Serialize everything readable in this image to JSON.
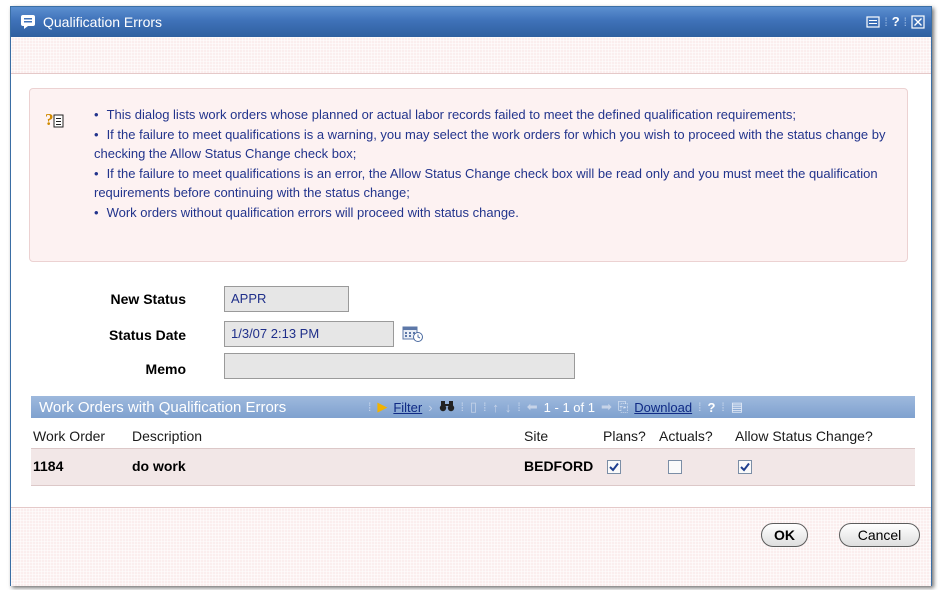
{
  "dialog": {
    "title": "Qualification Errors",
    "toolbar": {
      "help_label": "?"
    }
  },
  "help": {
    "bullets": [
      "This dialog lists work orders whose planned or actual labor records failed to meet the defined qualification requirements;",
      "If the failure to meet qualifications is a warning, you may select the work orders for which you wish to proceed with the status change by checking the Allow Status Change check box;",
      "If the failure to meet qualifications is an error, the Allow Status Change check box will be read only and you must meet the qualification requirements before continuing with the status change;",
      "Work orders without qualification errors will proceed with status change."
    ]
  },
  "form": {
    "new_status_label": "New Status",
    "new_status_value": "APPR",
    "status_date_label": "Status Date",
    "status_date_value": "1/3/07 2:13 PM",
    "memo_label": "Memo",
    "memo_value": ""
  },
  "table": {
    "title": "Work Orders with Qualification Errors",
    "filter_label": "Filter",
    "paging": "1 - 1 of 1",
    "download_label": "Download",
    "help_label": "?",
    "columns": [
      "Work Order",
      "Description",
      "Site",
      "Plans?",
      "Actuals?",
      "Allow Status Change?"
    ],
    "rows": [
      {
        "work_order": "1184",
        "description": "do work",
        "site": "BEDFORD",
        "plans": true,
        "actuals": false,
        "allow_status_change": true
      }
    ]
  },
  "buttons": {
    "ok": "OK",
    "cancel": "Cancel"
  },
  "colors": {
    "titlebar": "#3f72b9",
    "help_text": "#22348c",
    "band": "#fbeeee"
  }
}
